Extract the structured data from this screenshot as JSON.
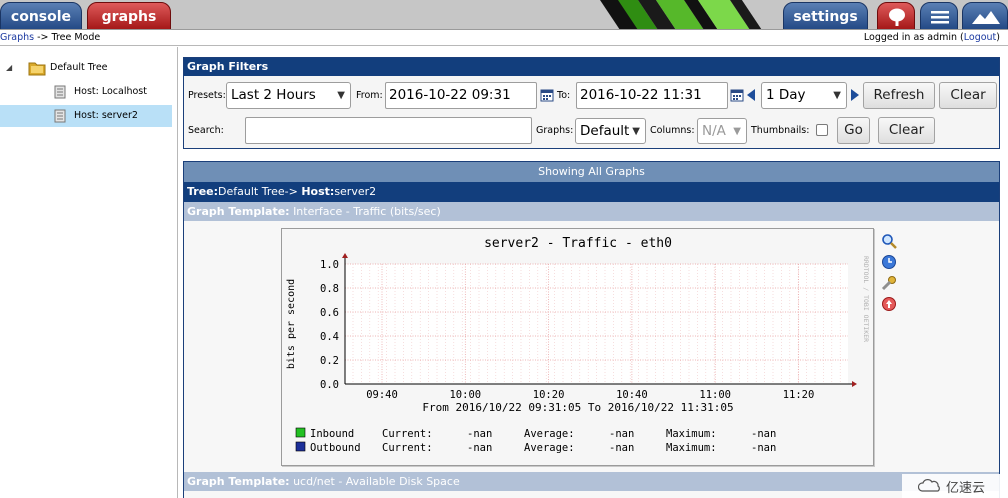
{
  "topbar": {
    "console_label": "console",
    "graphs_label": "graphs",
    "settings_label": "settings",
    "colors": {
      "blue": "#2c4f8c",
      "red": "#b52222",
      "stripe": "#3f9f1a"
    }
  },
  "breadcrumb": {
    "root": "Graphs",
    "separator": "->",
    "current": "Tree Mode",
    "login_prefix": "Logged in as admin (",
    "logout_label": "Logout",
    "login_suffix": ")"
  },
  "tree": {
    "expander": "◢",
    "root_label": "Default Tree",
    "hosts": [
      "Host: Localhost",
      "Host: server2"
    ],
    "selected_index": 1
  },
  "filters": {
    "title": "Graph Filters",
    "presets_label": "Presets:",
    "presets_value": "Last 2 Hours",
    "from_label": "From:",
    "from_value": "2016-10-22 09:31",
    "to_label": "To:",
    "to_value": "2016-10-22 11:31",
    "span_value": "1 Day",
    "refresh_label": "Refresh",
    "clear_label": "Clear",
    "search_label": "Search:",
    "search_value": "",
    "graphs_label": "Graphs:",
    "graphs_value": "Default",
    "columns_label": "Columns:",
    "columns_value": "N/A",
    "thumbnails_label": "Thumbnails:",
    "thumbnails_checked": false,
    "go_label": "Go",
    "clear2_label": "Clear"
  },
  "graphs": {
    "showing_label": "Showing All Graphs",
    "tree_prefix": "Tree:",
    "tree_name": "Default Tree",
    "tree_sep": "->",
    "host_prefix": "Host:",
    "host_name": "server2",
    "template1_prefix": "Graph Template:",
    "template1_name": "Interface - Traffic (bits/sec)",
    "template2_prefix": "Graph Template:",
    "template2_name": "ucd/net - Available Disk Space"
  },
  "rrd": {
    "title": "server2 - Traffic - eth0",
    "ylabel": "bits per second",
    "side_text": "RRDTOOL / TOBI OETIKER",
    "yticks": [
      "1.0",
      "0.8",
      "0.6",
      "0.4",
      "0.2",
      "0.0"
    ],
    "xticks": [
      "09:40",
      "10:00",
      "10:20",
      "10:40",
      "11:00",
      "11:20"
    ],
    "range_text": "From 2016/10/22 09:31:05 To 2016/10/22 11:31:05",
    "legend": [
      {
        "name": "Inbound",
        "color": "#22c022",
        "current_label": "Current:",
        "current": "-nan",
        "average_label": "Average:",
        "average": "-nan",
        "maximum_label": "Maximum:",
        "maximum": "-nan"
      },
      {
        "name": "Outbound",
        "color": "#1c2f99",
        "current_label": "Current:",
        "current": "-nan",
        "average_label": "Average:",
        "average": "-nan",
        "maximum_label": "Maximum:",
        "maximum": "-nan"
      }
    ]
  },
  "watermark": {
    "text": "亿速云"
  }
}
